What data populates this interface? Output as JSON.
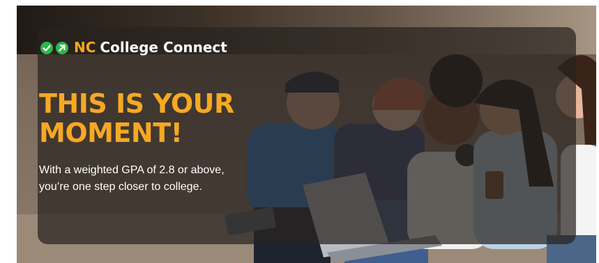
{
  "brand": {
    "nc": "NC",
    "name": "College Connect",
    "icons": [
      "check-circle-icon",
      "arrow-circle-icon"
    ],
    "icon_color": "#2ab84a"
  },
  "headline": {
    "line1": "THIS IS YOUR",
    "line2": "MOMENT!"
  },
  "body": "With a weighted GPA of 2.8 or above, you’re one step closer to college.",
  "colors": {
    "accent": "#f7a823",
    "overlay": "#28221e",
    "text": "#ffffff"
  }
}
